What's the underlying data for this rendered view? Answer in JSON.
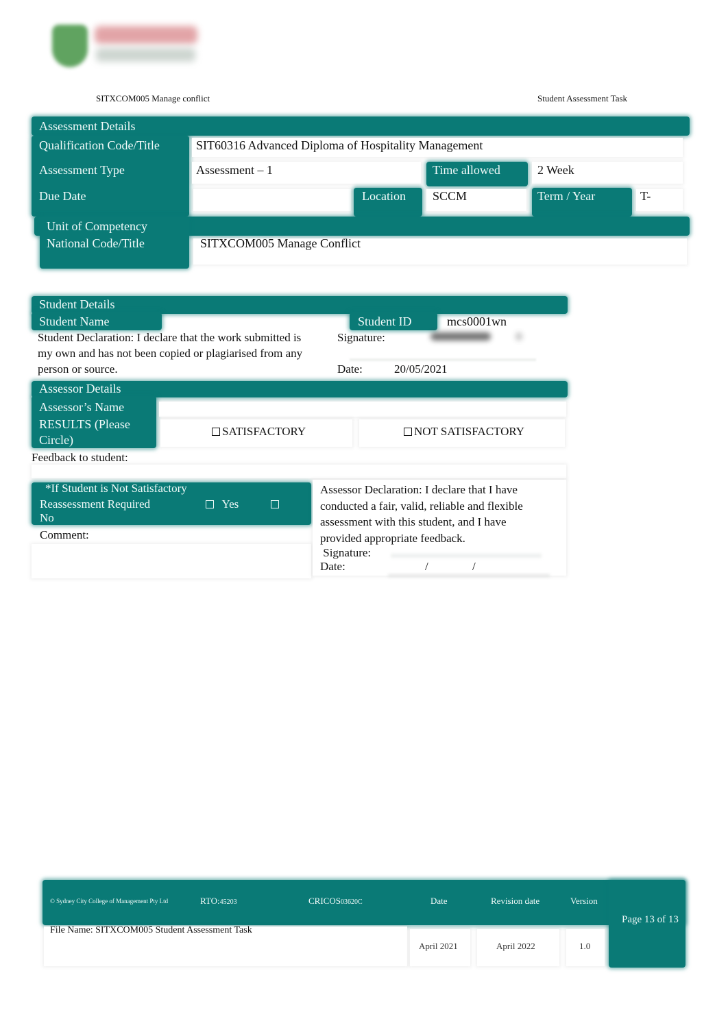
{
  "header": {
    "logo_alt": "Sydney City College of Management logo",
    "left_title": "SITXCOM005 Manage conflict",
    "right_title": "Student Assessment Task"
  },
  "assessment_details": {
    "section_label": "Assessment Details",
    "qualification_label": "Qualification Code/Title",
    "qualification_value": "SIT60316 Advanced Diploma of Hospitality Management",
    "type_label": "Assessment Type",
    "type_value": "Assessment – 1",
    "time_label": "Time allowed",
    "time_value": "2 Week",
    "due_label": "Due Date",
    "due_value": "",
    "location_label": "Location",
    "location_value": "SCCM",
    "term_label": "Term / Year",
    "term_value": "T-"
  },
  "unit": {
    "label_line1": "Unit of Competency",
    "label_line2": "National Code/Title",
    "value": "SITXCOM005 Manage Conflict"
  },
  "student_details": {
    "section_label": "Student Details",
    "name_label": "Student Name",
    "name_value": "",
    "id_label": "Student ID",
    "id_value": "mcs0001wn",
    "declaration": "Student Declaration:  I declare that the work submitted is my own and has not been copied or plagiarised from any person or source.",
    "signature_label": "Signature:",
    "date_label": "Date:",
    "date_value": "20/05/2021"
  },
  "assessor_details": {
    "section_label": "Assessor Details",
    "name_label": "Assessor’s Name",
    "name_value": "",
    "results_label": "RESULTS (Please Circle)",
    "option_satisfactory": "SATISFACTORY",
    "option_not_satisfactory": "NOT SATISFACTORY",
    "feedback_label": "Feedback to student:"
  },
  "reassessment": {
    "line1": "*If Student is Not Satisfactory",
    "label": "Reassessment Required",
    "yes_label": "Yes",
    "no_label": "No",
    "comment_label": "Comment:"
  },
  "assessor_declaration": {
    "text": "Assessor Declaration:  I declare that I have conducted a fair, valid, reliable and flexible assessment with this student, and I have provided appropriate feedback.",
    "signature_label": " Signature:",
    "date_label": "Date:",
    "date_sep1": "/",
    "date_sep2": "/"
  },
  "footer": {
    "copyright": "© Sydney City College of Management Pty Ltd",
    "rto_label": "RTO:",
    "rto_value": "45203",
    "cricos_label": "CRICOS",
    "cricos_value": "03620C",
    "date_header": "Date",
    "revision_header": "Revision date",
    "version_header": "Version",
    "date_value": "April 2021",
    "revision_value": "April 2022",
    "version_value": "1.0",
    "file_name": "File Name: SITXCOM005 Student Assessment Task",
    "page": "Page 13 of 13"
  },
  "colors": {
    "teal": "#0a7a76",
    "label_text": "#f2fbfa",
    "body_text": "#111111"
  }
}
